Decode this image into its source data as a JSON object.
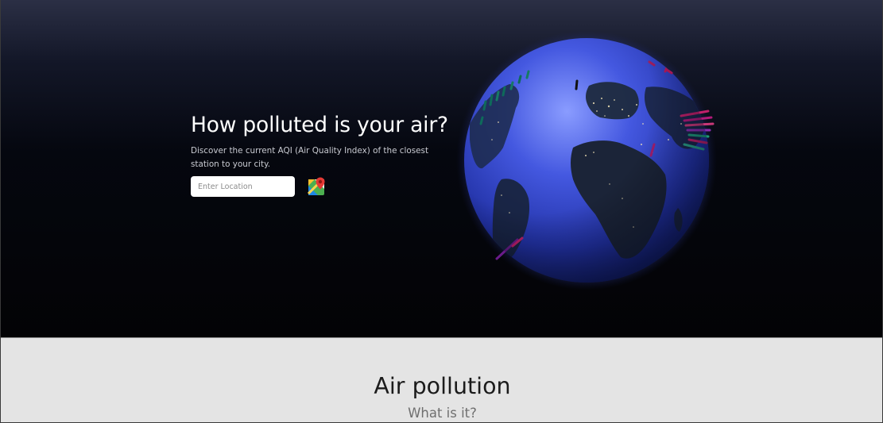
{
  "hero": {
    "title": "How polluted is your air?",
    "subtitle": "Discover the current AQI (Air Quality Index) of the closest station to your city.",
    "location_placeholder": "Enter Location",
    "maps_icon": "google-maps-pin-icon"
  },
  "section": {
    "title": "Air pollution",
    "subtitle": "What is it?"
  },
  "colors": {
    "hero_top": "#2b2f45",
    "hero_bottom": "#030305",
    "globe_ocean": "#3546c8",
    "section_bg": "#e4e4e4"
  }
}
